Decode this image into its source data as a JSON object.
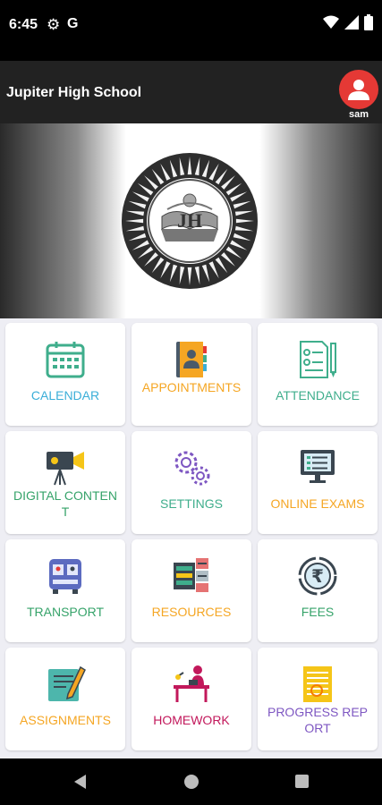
{
  "status_bar": {
    "time": "6:45",
    "g_label": "G"
  },
  "app_bar": {
    "title": "Jupiter High School",
    "user_name": "sam"
  },
  "colors": {
    "app_bar": "#222222",
    "avatar": "#e53935",
    "grid_bg": "#eeeef4"
  },
  "tiles": [
    {
      "label": "CALENDAR",
      "icon": "calendar-icon",
      "color": "#3aaed8"
    },
    {
      "label": "APPOINTMENTS",
      "icon": "appointment-book-icon",
      "color": "#f5a623"
    },
    {
      "label": "ATTENDANCE",
      "icon": "attendance-checklist-icon",
      "color": "#3fae8c"
    },
    {
      "label": "DIGITAL CONTENT",
      "icon": "video-camera-icon",
      "color": "#36a36a"
    },
    {
      "label": "SETTINGS",
      "icon": "gears-icon",
      "color": "#3fae8c"
    },
    {
      "label": "ONLINE EXAMS",
      "icon": "computer-monitor-icon",
      "color": "#f5a623"
    },
    {
      "label": "TRANSPORT",
      "icon": "bus-icon",
      "color": "#36a36a"
    },
    {
      "label": "RESOURCES",
      "icon": "server-rack-icon",
      "color": "#f5a623"
    },
    {
      "label": "FEES",
      "icon": "rupee-coin-icon",
      "color": "#36a36a"
    },
    {
      "label": "ASSIGNMENTS",
      "icon": "notebook-pen-icon",
      "color": "#f5a623"
    },
    {
      "label": "HOMEWORK",
      "icon": "student-desk-icon",
      "color": "#c2185b"
    },
    {
      "label": "PROGRESS REPORT",
      "icon": "report-document-icon",
      "color": "#7e57c2"
    }
  ]
}
